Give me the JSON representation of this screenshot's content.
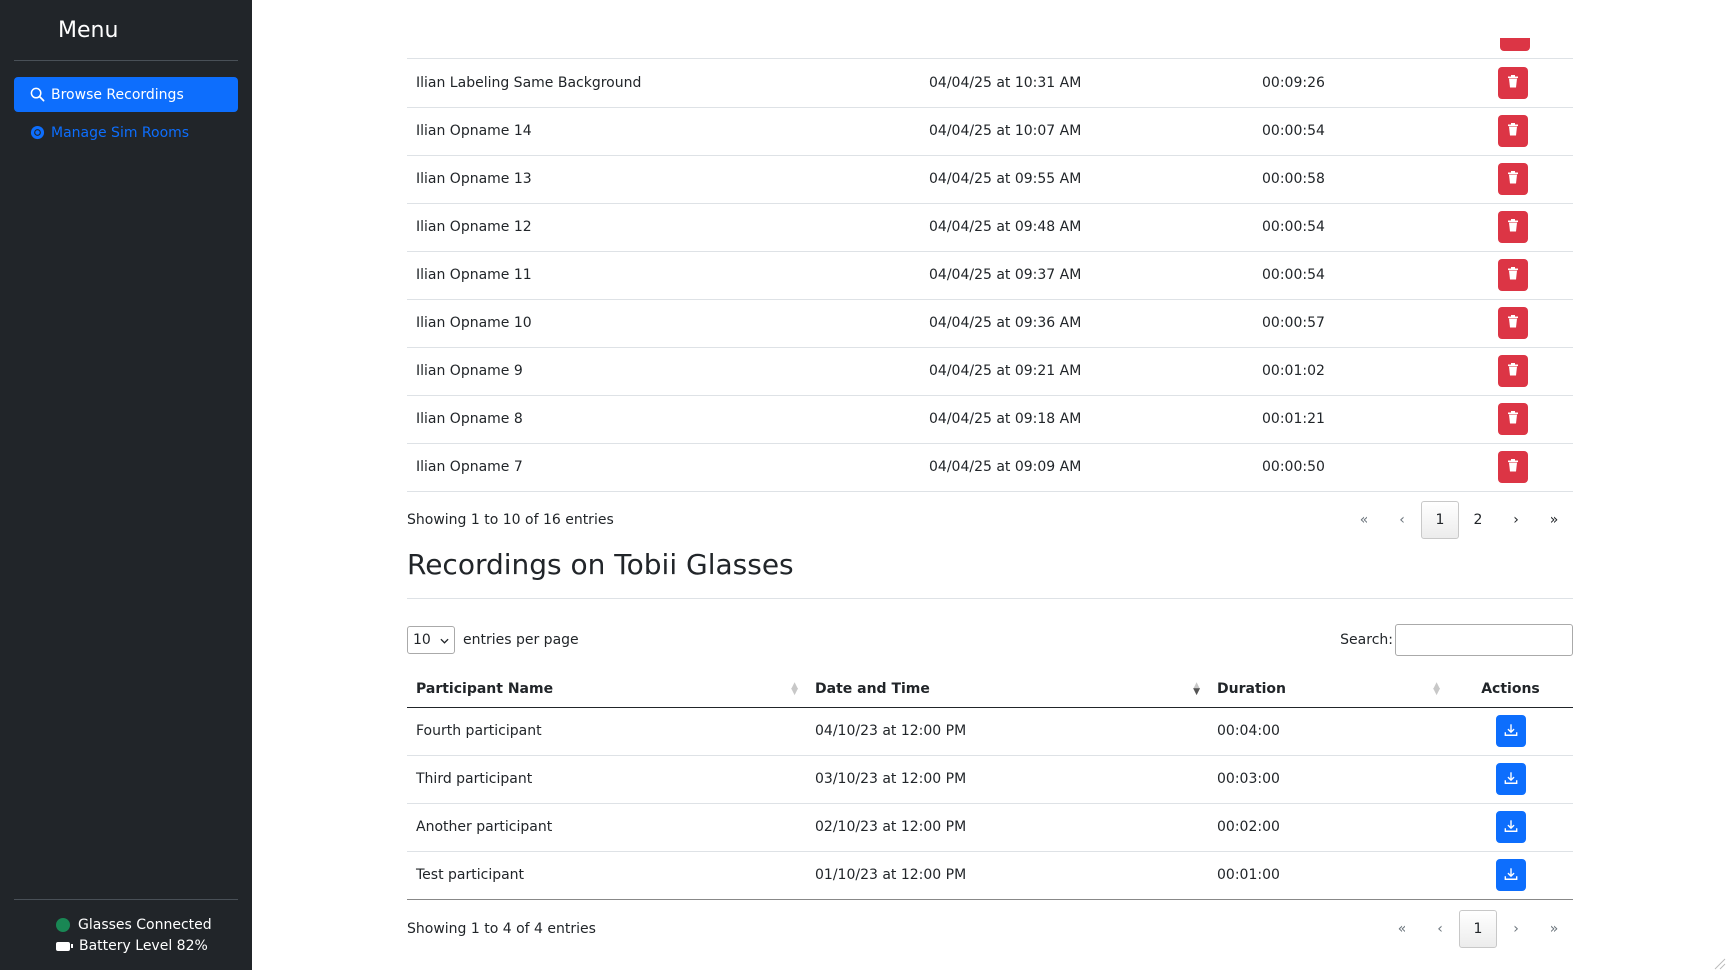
{
  "sidebar": {
    "title": "Menu",
    "items": [
      {
        "label": "Browse Recordings",
        "icon": "search-icon",
        "active": true
      },
      {
        "label": "Manage Sim Rooms",
        "icon": "circle-icon",
        "active": false
      }
    ],
    "status": {
      "connection": "Glasses Connected",
      "battery": "Battery Level 82%"
    }
  },
  "local_recordings": {
    "rows": [
      {
        "name": "Ilian Labeling Same Background",
        "date": "04/04/25 at 10:31 AM",
        "duration": "00:09:26"
      },
      {
        "name": "Ilian Opname 14",
        "date": "04/04/25 at 10:07 AM",
        "duration": "00:00:54"
      },
      {
        "name": "Ilian Opname 13",
        "date": "04/04/25 at 09:55 AM",
        "duration": "00:00:58"
      },
      {
        "name": "Ilian Opname 12",
        "date": "04/04/25 at 09:48 AM",
        "duration": "00:00:54"
      },
      {
        "name": "Ilian Opname 11",
        "date": "04/04/25 at 09:37 AM",
        "duration": "00:00:54"
      },
      {
        "name": "Ilian Opname 10",
        "date": "04/04/25 at 09:36 AM",
        "duration": "00:00:57"
      },
      {
        "name": "Ilian Opname 9",
        "date": "04/04/25 at 09:21 AM",
        "duration": "00:01:02"
      },
      {
        "name": "Ilian Opname 8",
        "date": "04/04/25 at 09:18 AM",
        "duration": "00:01:21"
      },
      {
        "name": "Ilian Opname 7",
        "date": "04/04/25 at 09:09 AM",
        "duration": "00:00:50"
      }
    ],
    "info": "Showing 1 to 10 of 16 entries",
    "pagination": {
      "first": "«",
      "prev": "‹",
      "pages": [
        "1",
        "2"
      ],
      "current": "1",
      "next": "›",
      "last": "»"
    }
  },
  "glasses_recordings": {
    "title": "Recordings on Tobii Glasses",
    "per_page_value": "10",
    "per_page_label": "entries per page",
    "search_label": "Search:",
    "search_value": "",
    "headers": {
      "name": "Participant Name",
      "date": "Date and Time",
      "duration": "Duration",
      "actions": "Actions"
    },
    "sorted_column": "date",
    "sort_direction": "desc",
    "rows": [
      {
        "name": "Fourth participant",
        "date": "04/10/23 at 12:00 PM",
        "duration": "00:04:00"
      },
      {
        "name": "Third participant",
        "date": "03/10/23 at 12:00 PM",
        "duration": "00:03:00"
      },
      {
        "name": "Another participant",
        "date": "02/10/23 at 12:00 PM",
        "duration": "00:02:00"
      },
      {
        "name": "Test participant",
        "date": "01/10/23 at 12:00 PM",
        "duration": "00:01:00"
      }
    ],
    "info": "Showing 1 to 4 of 4 entries",
    "pagination": {
      "first": "«",
      "prev": "‹",
      "pages": [
        "1"
      ],
      "current": "1",
      "next": "›",
      "last": "»"
    }
  },
  "colors": {
    "sidebar_bg": "#212529",
    "primary": "#0d6efd",
    "danger": "#dc3545",
    "success": "#198754"
  }
}
